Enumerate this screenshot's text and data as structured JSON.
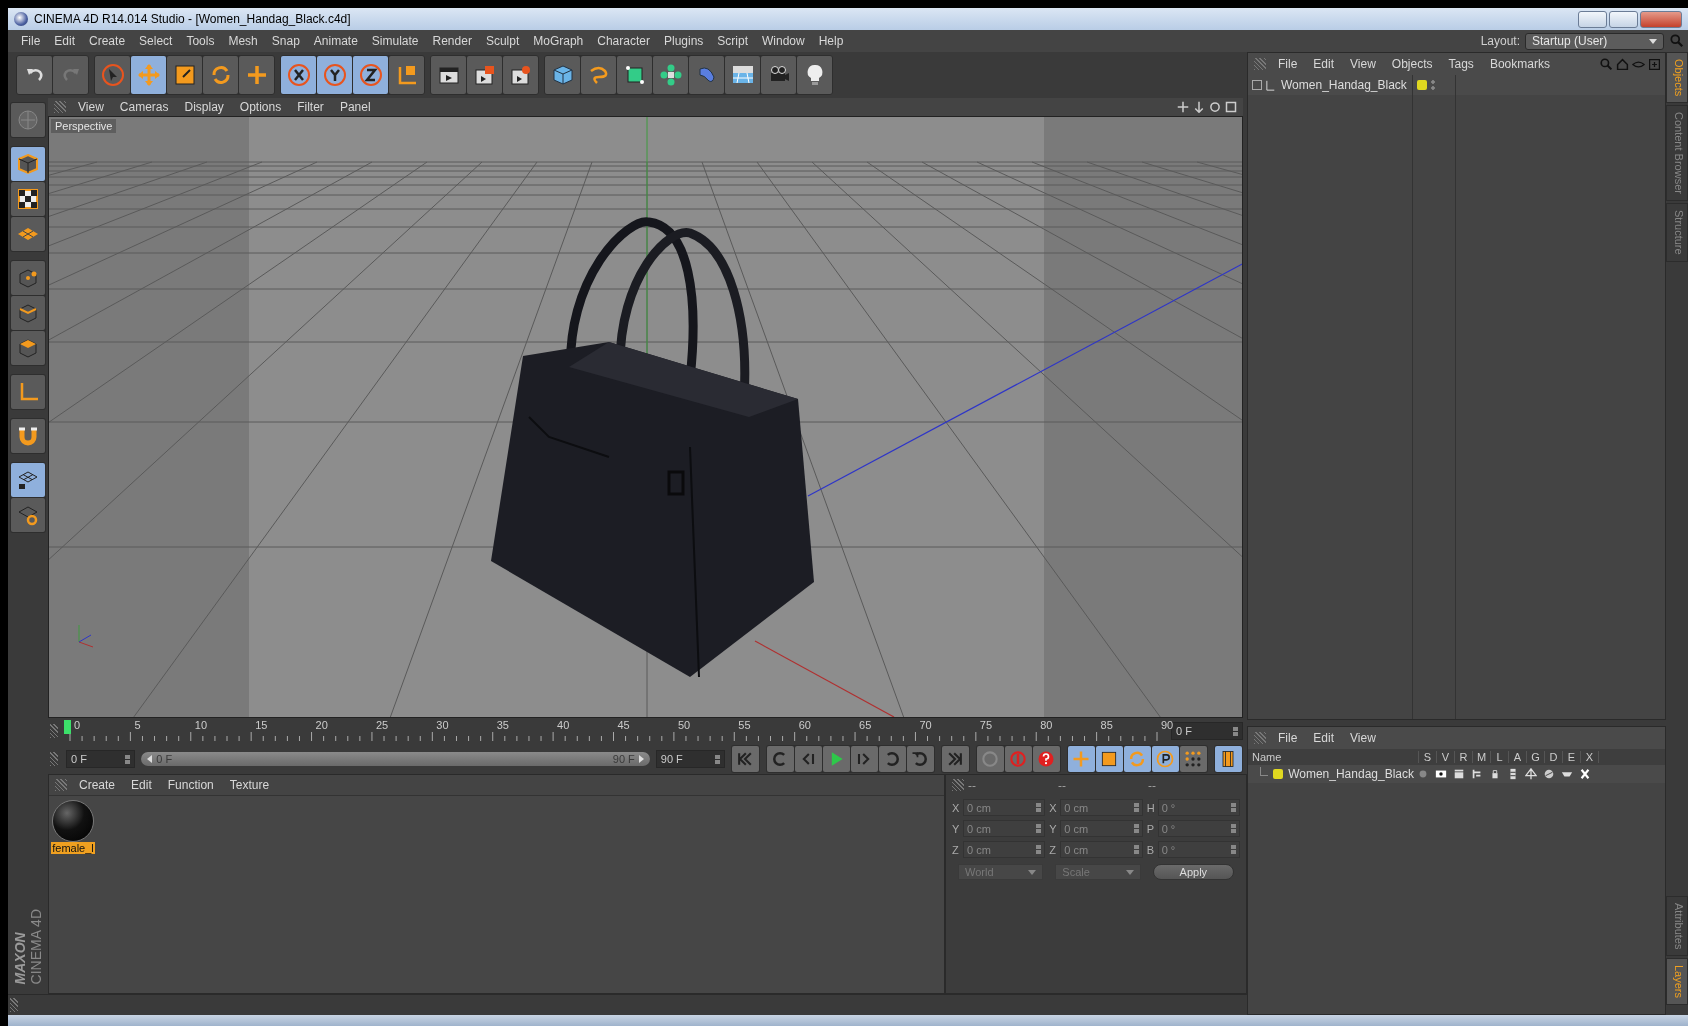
{
  "window": {
    "title": "CINEMA 4D R14.014 Studio - [Women_Handag_Black.c4d]"
  },
  "menu": [
    "File",
    "Edit",
    "Create",
    "Select",
    "Tools",
    "Mesh",
    "Snap",
    "Animate",
    "Simulate",
    "Render",
    "Sculpt",
    "MoGraph",
    "Character",
    "Plugins",
    "Script",
    "Window",
    "Help"
  ],
  "layout": {
    "label": "Layout:",
    "value": "Startup (User)"
  },
  "toolbar": [
    [
      {
        "kind": "undo",
        "selected": false
      },
      {
        "kind": "redo",
        "selected": false
      }
    ],
    [
      {
        "kind": "select",
        "selected": false
      },
      {
        "kind": "move",
        "selected": true
      },
      {
        "kind": "scale",
        "selected": false
      },
      {
        "kind": "rotate",
        "selected": false
      },
      {
        "kind": "add",
        "selected": false
      }
    ],
    [
      {
        "kind": "axis-x",
        "selected": true
      },
      {
        "kind": "axis-y",
        "selected": true
      },
      {
        "kind": "axis-z",
        "selected": true
      },
      {
        "kind": "coords",
        "selected": false
      }
    ],
    [
      {
        "kind": "render-view",
        "selected": false
      },
      {
        "kind": "render-picture",
        "selected": false
      },
      {
        "kind": "render-settings",
        "selected": false
      }
    ],
    [
      {
        "kind": "cube",
        "selected": false
      },
      {
        "kind": "spline",
        "selected": false
      },
      {
        "kind": "nurbs",
        "selected": false
      },
      {
        "kind": "array",
        "selected": false
      },
      {
        "kind": "deformer",
        "selected": false
      },
      {
        "kind": "floor",
        "selected": false
      },
      {
        "kind": "camera",
        "selected": false
      },
      {
        "kind": "light",
        "selected": false
      }
    ]
  ],
  "left_tools": [
    [
      {
        "kind": "model-mode",
        "selected": false
      }
    ],
    [
      {
        "kind": "object-mode",
        "selected": true
      },
      {
        "kind": "texture-mode",
        "selected": false
      },
      {
        "kind": "workplane-mode",
        "selected": false
      }
    ],
    [
      {
        "kind": "points",
        "selected": false
      },
      {
        "kind": "edges",
        "selected": false
      },
      {
        "kind": "polygons",
        "selected": false
      }
    ],
    [
      {
        "kind": "axis-mode",
        "selected": false
      }
    ],
    [
      {
        "kind": "magnet",
        "selected": false
      }
    ],
    [
      {
        "kind": "workplane-lock",
        "selected": true
      },
      {
        "kind": "workplane-snap",
        "selected": false
      }
    ]
  ],
  "logo": [
    "MAXON",
    "CINEMA 4D"
  ],
  "viewport": {
    "menu": [
      "View",
      "Cameras",
      "Display",
      "Options",
      "Filter",
      "Panel"
    ],
    "label": "Perspective"
  },
  "timeline": {
    "ruler": [
      "0",
      "5",
      "10",
      "15",
      "20",
      "25",
      "30",
      "35",
      "40",
      "45",
      "50",
      "55",
      "60",
      "65",
      "70",
      "75",
      "80",
      "85",
      "90"
    ],
    "current": "0 F",
    "start": "0 F",
    "range": {
      "start": "0 F",
      "end": "90 F",
      "level": 1
    },
    "end": "90 F",
    "transport": [
      {
        "kind": "first",
        "selected": false
      },
      {
        "kind": "prev-key",
        "selected": false
      },
      {
        "kind": "prev-frame",
        "selected": false
      },
      {
        "kind": "play",
        "selected": false
      },
      {
        "kind": "next-frame",
        "selected": false
      },
      {
        "kind": "next-key",
        "selected": false
      },
      {
        "kind": "loop",
        "selected": false
      },
      {
        "kind": "last",
        "selected": false
      }
    ],
    "keys": [
      {
        "kind": "keyframe",
        "selected": false
      },
      {
        "kind": "record",
        "selected": false
      },
      {
        "kind": "help",
        "selected": false
      },
      {
        "kind": "key-move",
        "selected": true
      },
      {
        "kind": "key-scale",
        "selected": true
      },
      {
        "kind": "key-rotate",
        "selected": true
      },
      {
        "kind": "key-param",
        "selected": true
      },
      {
        "kind": "key-points",
        "selected": false
      },
      {
        "kind": "timeline",
        "selected": true
      }
    ]
  },
  "materials": {
    "menu": [
      "Create",
      "Edit",
      "Function",
      "Texture"
    ],
    "items": [
      {
        "name": "female_l",
        "selected": true
      }
    ]
  },
  "coordinates": {
    "headers": [
      "--",
      "--",
      "--"
    ],
    "rows": [
      [
        {
          "label": "X",
          "value": "0 cm"
        },
        {
          "label": "X",
          "value": "0 cm"
        },
        {
          "label": "H",
          "value": "0 °"
        }
      ],
      [
        {
          "label": "Y",
          "value": "0 cm"
        },
        {
          "label": "Y",
          "value": "0 cm"
        },
        {
          "label": "P",
          "value": "0 °"
        }
      ],
      [
        {
          "label": "Z",
          "value": "0 cm"
        },
        {
          "label": "Z",
          "value": "0 cm"
        },
        {
          "label": "B",
          "value": "0 °"
        }
      ]
    ],
    "dropdowns": [
      "World",
      "Scale"
    ],
    "apply": "Apply"
  },
  "objects": {
    "menu": [
      "File",
      "Edit",
      "View",
      "Objects",
      "Tags",
      "Bookmarks"
    ],
    "items": [
      {
        "name": "Women_Handag_Black",
        "color": "#e0d820"
      }
    ]
  },
  "layers": {
    "menu": [
      "File",
      "Edit",
      "View"
    ],
    "columns": [
      "Name",
      "S",
      "V",
      "R",
      "M",
      "L",
      "A",
      "G",
      "D",
      "E",
      "X"
    ],
    "rows": [
      {
        "name": "Women_Handag_Black",
        "color": "#e0d820"
      }
    ]
  },
  "side_tabs_top": [
    {
      "label": "Objects",
      "selected": true
    },
    {
      "label": "Content Browser",
      "selected": false
    },
    {
      "label": "Structure",
      "selected": false
    }
  ],
  "side_tabs_bottom": [
    {
      "label": "Attributes",
      "selected": false
    },
    {
      "label": "Layers",
      "selected": true
    }
  ]
}
